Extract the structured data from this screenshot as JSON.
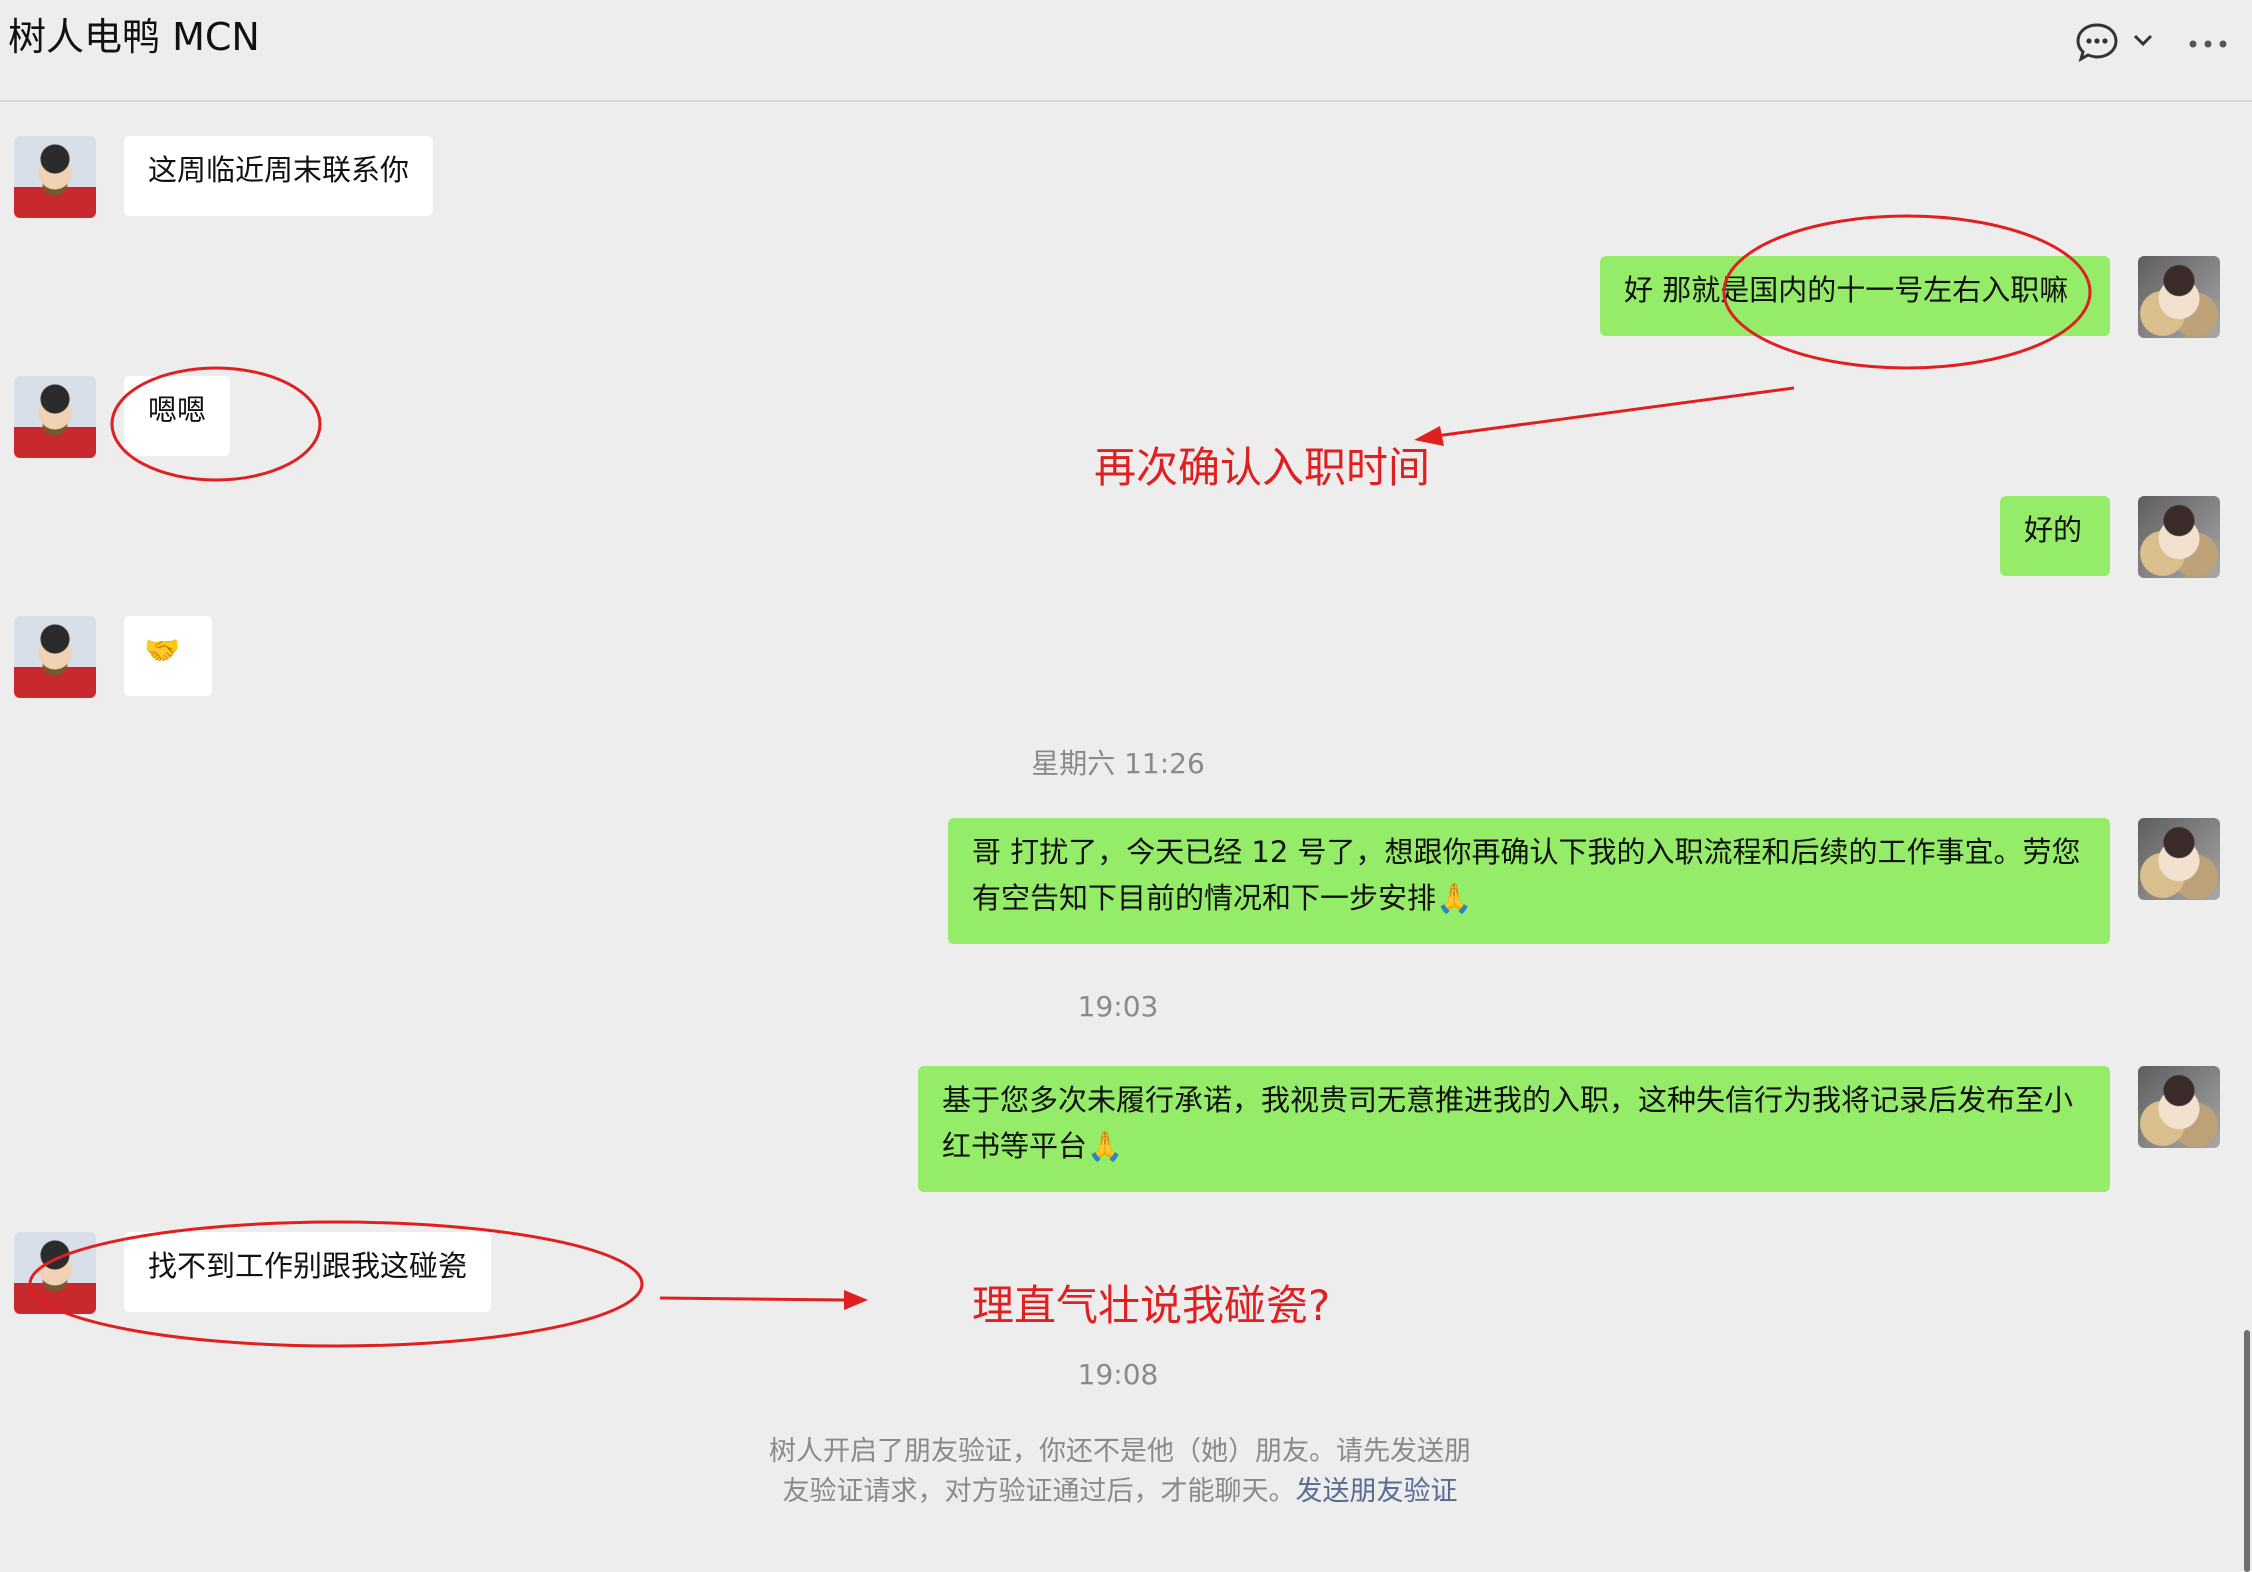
{
  "header": {
    "title": "树人电鸭 MCN"
  },
  "icons": {
    "chat": "chat-bubble-icon",
    "chevron": "chevron-down-icon",
    "more": "more-icon"
  },
  "messages": [
    {
      "side": "left",
      "text": "这周临近周末联系你"
    },
    {
      "side": "right",
      "text": "好 那就是国内的十一号左右入职嘛"
    },
    {
      "side": "left",
      "text": "嗯嗯"
    },
    {
      "side": "right",
      "text": "好的"
    },
    {
      "side": "left",
      "text": "🤝"
    },
    {
      "side": "right",
      "text": "哥 打扰了，今天已经 12 号了，想跟你再确认下我的入职流程和后续的工作事宜。劳您有空告知下目前的情况和下一步安排🙏"
    },
    {
      "side": "right",
      "text": "基于您多次未履行承诺，我视贵司无意推进我的入职，这种失信行为我将记录后发布至小红书等平台🙏"
    },
    {
      "side": "left",
      "text": "找不到工作别跟我这碰瓷"
    }
  ],
  "timestamps": [
    "星期六 11:26",
    "19:03",
    "19:08"
  ],
  "annotations": {
    "confirm_time": "再次确认入职时间",
    "scam_question": "理直气壮说我碰瓷?"
  },
  "notice": {
    "text": "树人开启了朋友验证，你还不是他（她）朋友。请先发送朋友验证请求，对方验证通过后，才能聊天。",
    "link": "发送朋友验证"
  },
  "colors": {
    "background": "#ededed",
    "right_bubble": "#95ec69",
    "left_bubble": "#ffffff",
    "annotation_red": "#e02020",
    "link": "#576b95"
  }
}
